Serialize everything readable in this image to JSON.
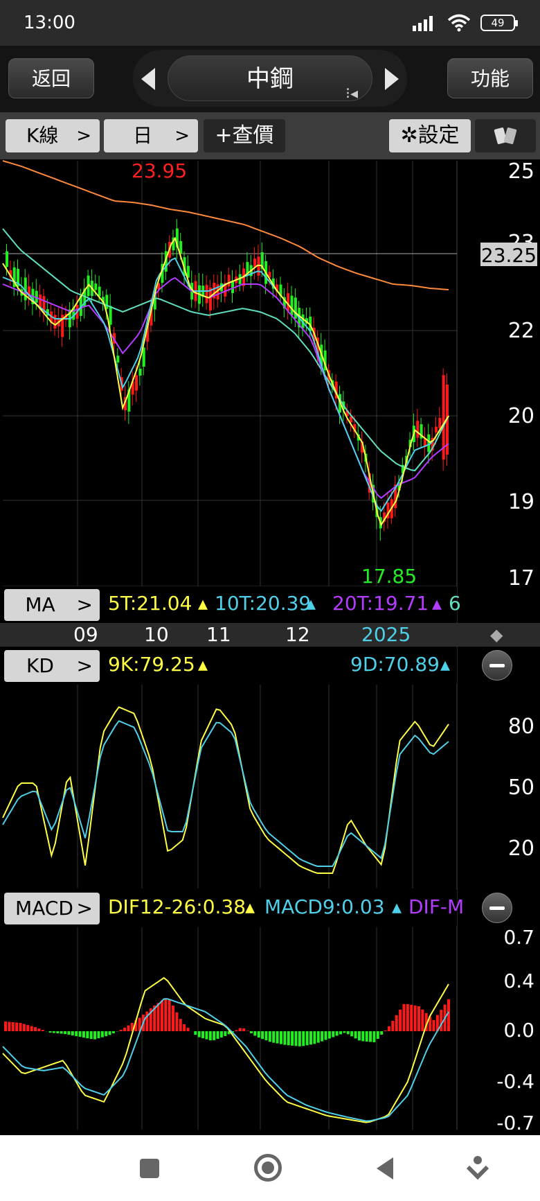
{
  "status_bar": {
    "time": "13:00",
    "battery": "49"
  },
  "nav": {
    "back": "返回",
    "title": "中鋼",
    "function": "功能"
  },
  "toolbar": {
    "kline": "K線",
    "period": "日",
    "query": "+查價",
    "settings": "設定"
  },
  "price_chart": {
    "high_label": "23.95",
    "low_label": "17.85",
    "current_price": "23.25",
    "y_ticks": [
      "25",
      "23",
      "22",
      "20",
      "19",
      "17"
    ]
  },
  "ma_bar": {
    "label": "MA",
    "ma5": "5T:21.04",
    "ma10": "10T:20.39",
    "ma20": "20T:19.71",
    "ma_more": "6"
  },
  "months": [
    "09",
    "10",
    "11",
    "12",
    "2025"
  ],
  "kd_bar": {
    "label": "KD",
    "k": "9K:79.25",
    "d": "9D:70.89",
    "y_ticks": [
      "80",
      "50",
      "20"
    ]
  },
  "macd_bar": {
    "label": "MACD",
    "dif": "DIF12-26:0.38",
    "macd": "MACD9:0.03",
    "osc": "DIF-M",
    "y_ticks": [
      "0.7",
      "0.4",
      "0.0",
      "-0.4",
      "-0.7"
    ]
  },
  "colors": {
    "up": "#ff1a1a",
    "down": "#22ee22",
    "ma5": "#ffff44",
    "ma10": "#4fd0ea",
    "ma20": "#b33cff",
    "ma60": "#5fe0c0",
    "ma240": "#ff8a3c"
  },
  "chart_data": {
    "type": "candlestick",
    "title": "中鋼",
    "x_months": [
      "09",
      "10",
      "11",
      "12",
      "2025"
    ],
    "ylim": [
      17,
      25
    ],
    "highest": 23.95,
    "lowest": 17.85,
    "close": 23.25,
    "series": [
      {
        "name": "5T",
        "last": 21.04
      },
      {
        "name": "10T",
        "last": 20.39
      },
      {
        "name": "20T",
        "last": 19.71
      }
    ],
    "kd": {
      "K": 79.25,
      "D": 70.89,
      "ylim": [
        0,
        100
      ]
    },
    "macd": {
      "DIF": 0.38,
      "MACD": 0.03,
      "ylim": [
        -0.7,
        0.7
      ]
    }
  }
}
